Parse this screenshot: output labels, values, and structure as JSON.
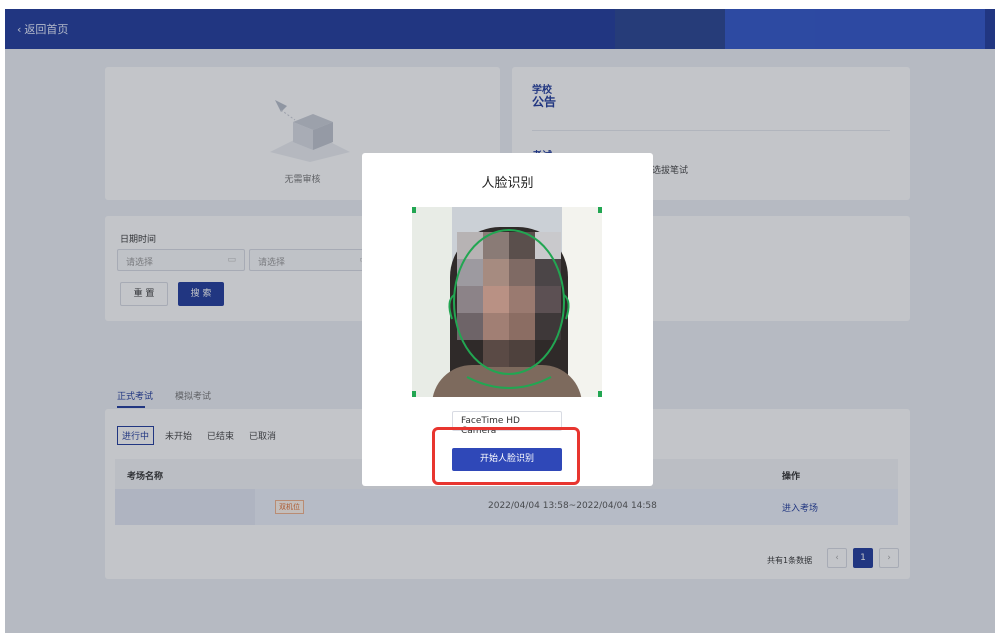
{
  "header": {
    "back_label": "返回首页"
  },
  "empty_review": {
    "text": "无需审核"
  },
  "notice": {
    "title_top": "学校",
    "title_main": "公告",
    "exam_title": "考试",
    "exam_text": "选拔笔试"
  },
  "search": {
    "date_label": "日期时间",
    "start_placeholder": "请选择",
    "end_placeholder": "请选择",
    "separator": "-",
    "reset_label": "重 置",
    "search_label": "搜 索"
  },
  "tabs": [
    {
      "label": "正式考试",
      "active": true
    },
    {
      "label": "模拟考试",
      "active": false
    }
  ],
  "filters": [
    {
      "label": "进行中",
      "active": true
    },
    {
      "label": "未开始",
      "active": false
    },
    {
      "label": "已结束",
      "active": false
    },
    {
      "label": "已取消",
      "active": false
    }
  ],
  "table": {
    "headers": {
      "name": "考场名称",
      "action": "操作"
    },
    "rows": [
      {
        "tag": "双机位",
        "time": "2022/04/04 13:58~2022/04/04 14:58",
        "action": "进入考场"
      }
    ]
  },
  "pagination": {
    "total_text": "共有1条数据",
    "prev_icon": "‹",
    "current": "1",
    "next_icon": "›"
  },
  "modal": {
    "title": "人脸识别",
    "camera_option": "FaceTime HD Camera",
    "start_label": "开始人脸识别"
  },
  "colors": {
    "primary": "#1f3a9b",
    "highlight": "#e8352f",
    "face_guide": "#22a652"
  }
}
